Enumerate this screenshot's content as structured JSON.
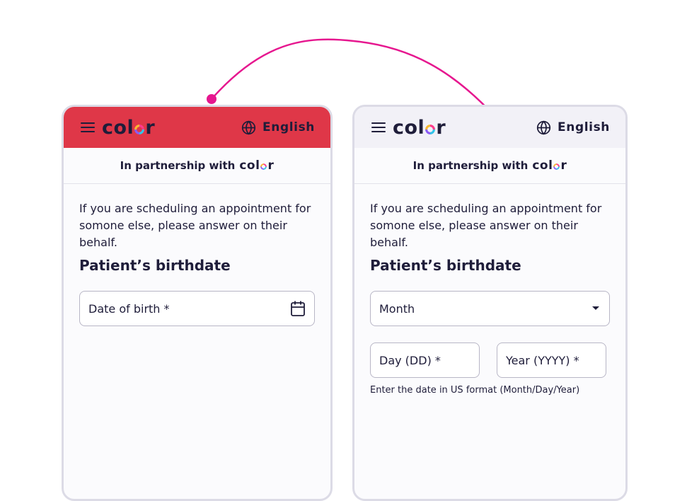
{
  "brand": {
    "logo_text_before": "col",
    "logo_text_after": "r"
  },
  "left_screen": {
    "header": {
      "language_label": "English",
      "accent_color": "#df3748"
    },
    "partnership_label": "In partnership with",
    "intro_text": "If you are scheduling an appointment for somone else, please answer on their behalf.",
    "heading": "Patient’s birthdate",
    "date_field": {
      "label": "Date of birth *",
      "icon": "calendar-icon"
    }
  },
  "right_screen": {
    "header": {
      "language_label": "English",
      "background_color": "#f2f1f7"
    },
    "partnership_label": "In partnership with",
    "intro_text": "If you are scheduling an appointment for somone else, please answer on their behalf.",
    "heading": "Patient’s birthdate",
    "month_select": {
      "label": "Month",
      "icon": "caret-down-icon"
    },
    "day_field": {
      "label": "Day (DD) *"
    },
    "year_field": {
      "label": "Year (YYYY) *"
    },
    "helper_text": "Enter the date in US format (Month/Day/Year)"
  },
  "annotation": {
    "arrow_color": "#e6178f"
  }
}
